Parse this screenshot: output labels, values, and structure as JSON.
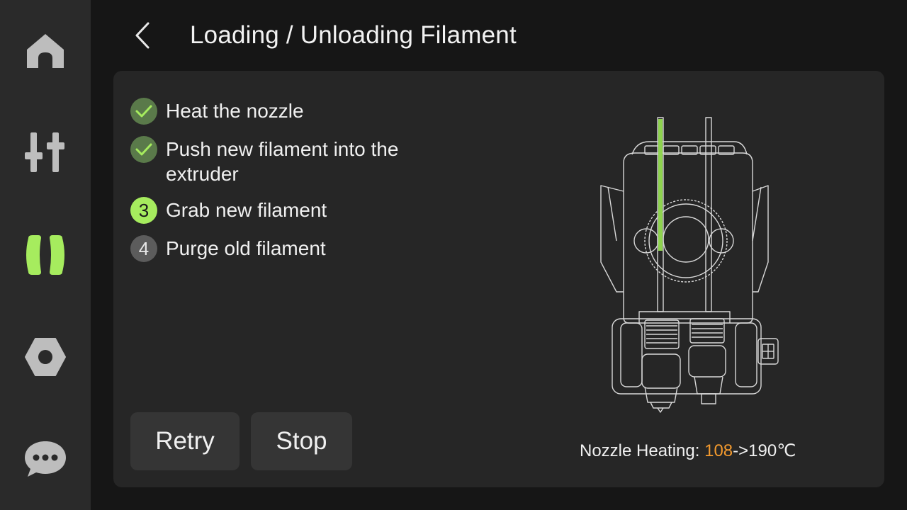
{
  "colors": {
    "accent": "#a6ec5e",
    "done_badge": "#5a7a4a",
    "pending_badge": "#5c5c5c",
    "temp_current": "#f39a2e",
    "sidebar_bg": "#2a2a2a",
    "panel_bg": "#262626"
  },
  "sidebar": {
    "items": [
      {
        "icon": "home-icon",
        "active": false
      },
      {
        "icon": "sliders-icon",
        "active": false
      },
      {
        "icon": "filament-spool-icon",
        "active": true
      },
      {
        "icon": "hex-nut-icon",
        "active": false
      },
      {
        "icon": "chat-bubble-icon",
        "active": false
      }
    ]
  },
  "header": {
    "back_icon": "chevron-left-icon",
    "title": "Loading / Unloading Filament"
  },
  "steps": [
    {
      "status": "done",
      "badge": "",
      "label": "Heat the nozzle"
    },
    {
      "status": "done",
      "badge": "",
      "label": "Push new filament into the extruder"
    },
    {
      "status": "active",
      "badge": "3",
      "label": "Grab new filament"
    },
    {
      "status": "pending",
      "badge": "4",
      "label": "Purge old filament"
    }
  ],
  "buttons": {
    "retry": "Retry",
    "stop": "Stop"
  },
  "heating": {
    "label": "Nozzle Heating: ",
    "current": "108",
    "arrow": "->",
    "target": "190℃"
  },
  "diagram": {
    "icon": "extruder-toolhead-diagram"
  }
}
